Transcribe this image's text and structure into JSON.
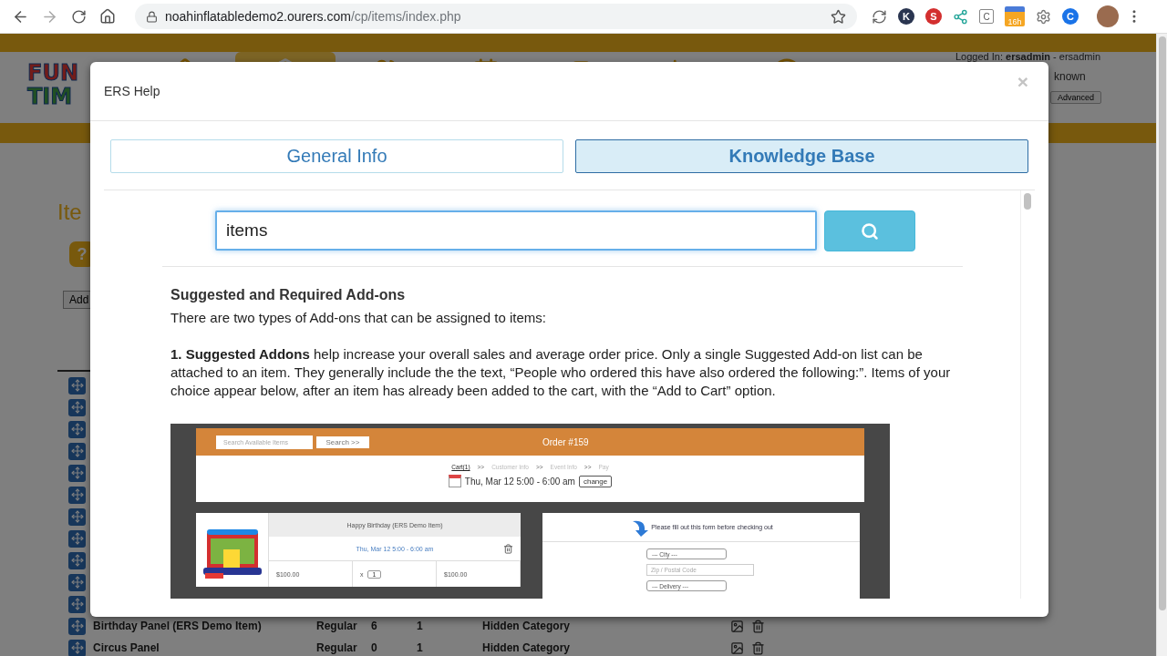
{
  "browser": {
    "url_domain": "noahinflatabledemo2.ourers.com",
    "url_path": "/cp/items/index.php",
    "extensions": [
      {
        "kind": "sync"
      },
      {
        "kind": "letter",
        "text": "K",
        "color": "#2a3550"
      },
      {
        "kind": "letter",
        "text": "S",
        "color": "#d32f2f"
      },
      {
        "kind": "network"
      },
      {
        "kind": "boxed",
        "text": "C"
      },
      {
        "kind": "badge",
        "text": "16h"
      },
      {
        "kind": "gear"
      },
      {
        "kind": "letter",
        "text": "C",
        "color": "#1a73e8"
      }
    ]
  },
  "page": {
    "logo": {
      "line1": "FUN",
      "line2": "TIM"
    },
    "nav_tabs": [
      {
        "selected": false
      },
      {
        "selected": true
      },
      {
        "selected": false
      },
      {
        "selected": false
      },
      {
        "selected": false
      },
      {
        "selected": false
      },
      {
        "selected": false
      }
    ],
    "login": "Logged In: **ersadmin** - ersadmin",
    "status": "known",
    "advanced_button": "Advanced",
    "heading": "Ite",
    "help_button": "?",
    "add_button": "Add",
    "rows": [
      {
        "kind": "covered"
      },
      {
        "kind": "covered"
      },
      {
        "kind": "covered"
      },
      {
        "kind": "covered"
      },
      {
        "kind": "covered"
      },
      {
        "kind": "covered"
      },
      {
        "kind": "covered"
      },
      {
        "kind": "covered"
      },
      {
        "kind": "covered"
      },
      {
        "kind": "covered"
      },
      {
        "kind": "covered"
      },
      {
        "kind": "full",
        "name": "Birthday Panel (ERS Demo Item)",
        "type": "Regular",
        "column_3": "6",
        "column_4": "1",
        "category": "Hidden Category"
      },
      {
        "kind": "full",
        "name": "Circus Panel",
        "type": "Regular",
        "column_3": "0",
        "column_4": "1",
        "category": "Hidden Category"
      }
    ]
  },
  "modal": {
    "title": "ERS Help",
    "close": "×",
    "tabs": [
      {
        "label": "General Info",
        "selected": false
      },
      {
        "label": "Knowledge Base",
        "selected": true
      }
    ],
    "search": {
      "value": "items"
    },
    "article": {
      "title": "Suggested and Required Add-ons",
      "paragraphs": [
        "There are two types of Add-ons that can be assigned to items:",
        "**1. Suggested Addons** help increase your overall sales and average order price. Only a single Suggested Add-on list can be attached to an item. They generally include the the text, “People who ordered this have also ordered the following:”. Items of your choice appear below, after an item has already been added to the cart, with the “Add to Cart” option."
      ],
      "screenshot": {
        "search_placeholder": "Search Available Items",
        "search_button": "Search >>",
        "order_title": "Order #159",
        "breadcrumb": [
          {
            "kind": "step",
            "label": "Cart(1)",
            "selected": true
          },
          {
            "kind": "separator",
            "label": ">>"
          },
          {
            "kind": "step",
            "label": "Customer Info",
            "selected": false
          },
          {
            "kind": "separator",
            "label": ">>"
          },
          {
            "kind": "step",
            "label": "Event Info",
            "selected": false
          },
          {
            "kind": "separator",
            "label": ">>"
          },
          {
            "kind": "step",
            "label": "Pay",
            "selected": false
          }
        ],
        "date": "Thu, Mar 12 5:00 - 6:00 am",
        "change_button": "change",
        "item": {
          "name": "Happy Birthday (ERS Demo Item)",
          "date": "Thu, Mar 12 5:00 - 6:00 am",
          "price": "$100.00",
          "times": "x",
          "quantity": "1",
          "total": "$100.00"
        },
        "form": {
          "notice": "Please fill out this form before checking out",
          "city": "--- City ---",
          "zip_placeholder": "Zip / Postal Code",
          "delivery": "--- Delivery ---"
        }
      }
    }
  }
}
